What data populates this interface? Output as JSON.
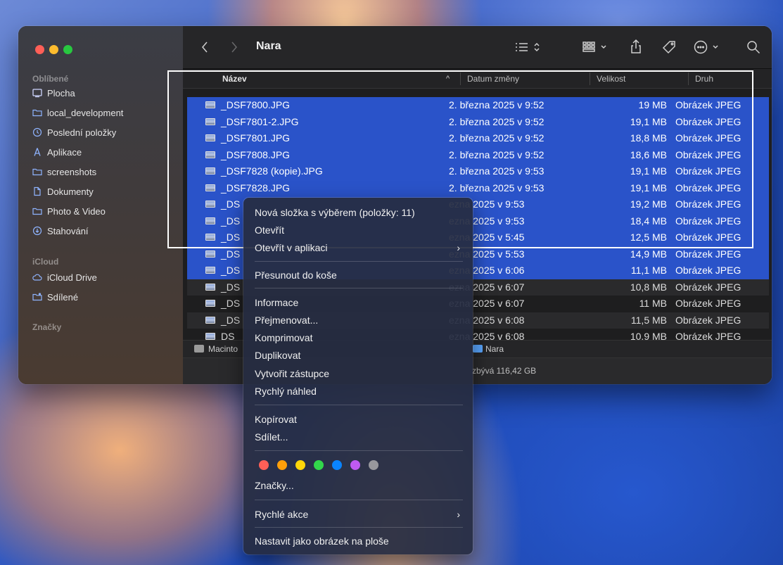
{
  "window": {
    "title": "Nara"
  },
  "sidebar": {
    "sections": [
      {
        "title": "Oblíbené",
        "items": [
          {
            "label": "Plocha",
            "icon": "desktop-icon"
          },
          {
            "label": "local_development",
            "icon": "folder-icon"
          },
          {
            "label": "Poslední položky",
            "icon": "clock-icon"
          },
          {
            "label": "Aplikace",
            "icon": "applications-icon"
          },
          {
            "label": "screenshots",
            "icon": "folder-icon"
          },
          {
            "label": "Dokumenty",
            "icon": "document-icon"
          },
          {
            "label": "Photo & Video",
            "icon": "folder-icon"
          },
          {
            "label": "Stahování",
            "icon": "download-icon"
          }
        ]
      },
      {
        "title": "iCloud",
        "items": [
          {
            "label": "iCloud Drive",
            "icon": "cloud-icon"
          },
          {
            "label": "Sdílené",
            "icon": "shared-folder-icon"
          }
        ]
      },
      {
        "title": "Značky",
        "items": []
      }
    ]
  },
  "columns": {
    "name": "Název",
    "date": "Datum změny",
    "size": "Velikost",
    "kind": "Druh"
  },
  "files": [
    {
      "name": "_DSF7800.JPG",
      "date": "2. března 2025 v 9:52",
      "size": "19 MB",
      "kind": "Obrázek JPEG",
      "selected": true
    },
    {
      "name": "_DSF7801-2.JPG",
      "date": "2. března 2025 v 9:52",
      "size": "19,1 MB",
      "kind": "Obrázek JPEG",
      "selected": true
    },
    {
      "name": "_DSF7801.JPG",
      "date": "2. března 2025 v 9:52",
      "size": "18,8 MB",
      "kind": "Obrázek JPEG",
      "selected": true
    },
    {
      "name": "_DSF7808.JPG",
      "date": "2. března 2025 v 9:52",
      "size": "18,6 MB",
      "kind": "Obrázek JPEG",
      "selected": true
    },
    {
      "name": "_DSF7828 (kopie).JPG",
      "date": "2. března 2025 v 9:53",
      "size": "19,1 MB",
      "kind": "Obrázek JPEG",
      "selected": true
    },
    {
      "name": "_DSF7828.JPG",
      "date": "2. března 2025 v 9:53",
      "size": "19,1 MB",
      "kind": "Obrázek JPEG",
      "selected": true
    },
    {
      "name": "_DS",
      "date": "ezna 2025 v 9:53",
      "size": "19,2 MB",
      "kind": "Obrázek JPEG",
      "selected": true
    },
    {
      "name": "_DS",
      "date": "ezna 2025 v 9:53",
      "size": "18,4 MB",
      "kind": "Obrázek JPEG",
      "selected": true
    },
    {
      "name": "_DS",
      "date": "ezna 2025 v 5:45",
      "size": "12,5 MB",
      "kind": "Obrázek JPEG",
      "selected": true
    },
    {
      "name": "_DS",
      "date": "ezna 2025 v 5:53",
      "size": "14,9 MB",
      "kind": "Obrázek JPEG",
      "selected": true
    },
    {
      "name": "_DS",
      "date": "ezna 2025 v 6:06",
      "size": "11,1 MB",
      "kind": "Obrázek JPEG",
      "selected": true
    },
    {
      "name": "_DS",
      "date": "ezna 2025 v 6:07",
      "size": "10,8 MB",
      "kind": "Obrázek JPEG",
      "selected": false
    },
    {
      "name": "_DS",
      "date": "ezna 2025 v 6:07",
      "size": "11 MB",
      "kind": "Obrázek JPEG",
      "selected": false
    },
    {
      "name": "_DS",
      "date": "ezna 2025 v 6:08",
      "size": "11,5 MB",
      "kind": "Obrázek JPEG",
      "selected": false
    },
    {
      "name": "DS",
      "date": "ezna 2025 v 6:08",
      "size": "10.9 MB",
      "kind": "Obrázek JPEG",
      "selected": false
    }
  ],
  "pathbar": {
    "disk": "Macinto",
    "folder": "Nara"
  },
  "status": {
    "free": "zbývá 116,42 GB"
  },
  "context_menu": {
    "groups": [
      [
        {
          "label": "Nová složka s výběrem (položky: 11)"
        },
        {
          "label": "Otevřít"
        },
        {
          "label": "Otevřít v aplikaci",
          "submenu": true
        }
      ],
      [
        {
          "label": "Přesunout do koše"
        }
      ],
      [
        {
          "label": "Informace"
        },
        {
          "label": "Přejmenovat..."
        },
        {
          "label": "Komprimovat"
        },
        {
          "label": "Duplikovat"
        },
        {
          "label": "Vytvořit zástupce"
        },
        {
          "label": "Rychlý náhled"
        }
      ],
      [
        {
          "label": "Kopírovat"
        },
        {
          "label": "Sdílet..."
        }
      ],
      [
        {
          "label": "Značky..."
        }
      ],
      [
        {
          "label": "Rychlé akce",
          "submenu": true
        }
      ],
      [
        {
          "label": "Nastavit jako obrázek na ploše"
        }
      ]
    ],
    "tag_colors": [
      "#ff5f57",
      "#ff9f0a",
      "#ffd60a",
      "#32d74b",
      "#0a84ff",
      "#bf5af2",
      "#98989d"
    ],
    "submenu_glyph": "›"
  }
}
